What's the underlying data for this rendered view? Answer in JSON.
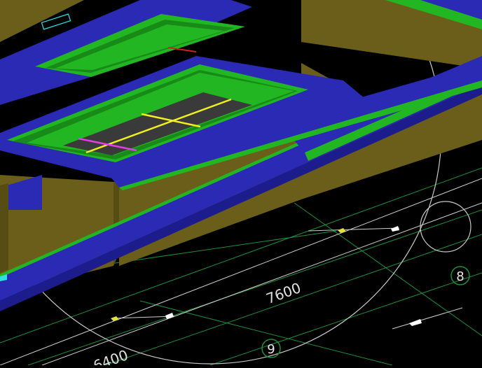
{
  "viewport": {
    "dimension_7600": "7600",
    "dimension_6400": "6400",
    "axis_bubble_8": "8",
    "axis_bubble_9": "9"
  },
  "colors": {
    "background": "#000000",
    "beam_blue": "#2a2ab4",
    "beam_blue_dark": "#1c1c8c",
    "wall_olive": "#6b5e1a",
    "wall_olive_dark": "#574c12",
    "slab_green": "#22b622",
    "slab_green_edge": "#178a17",
    "floor_dark": "#3a3a3a",
    "grid_green": "#1e8f3a",
    "dim_white": "#d8d8d8",
    "highlight_yellow": "#f0f020",
    "highlight_magenta": "#e040e0",
    "marker_cyan": "#30e0e0"
  }
}
